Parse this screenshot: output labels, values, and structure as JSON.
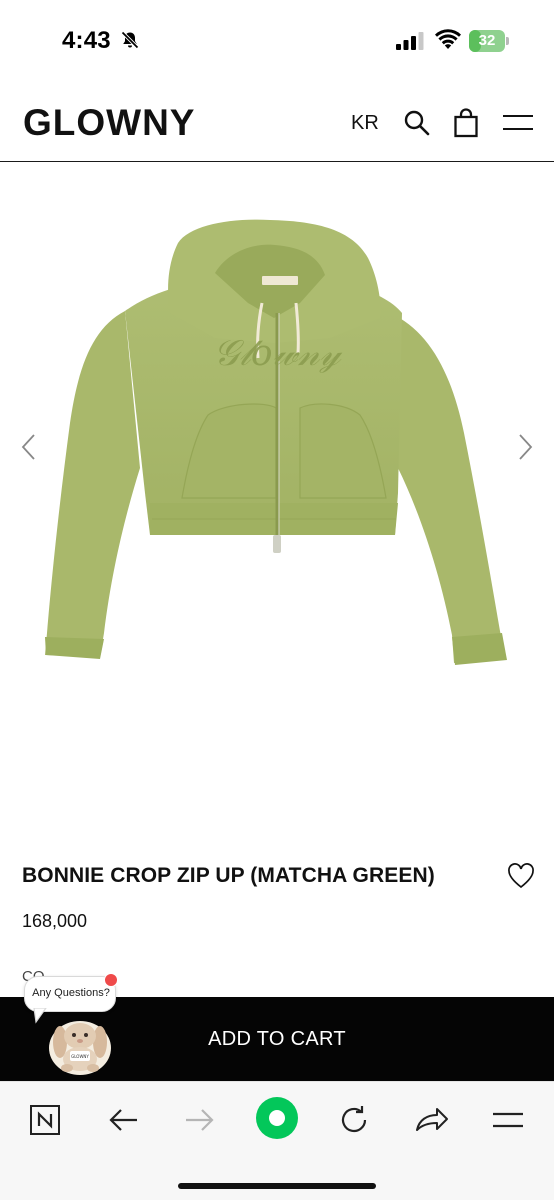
{
  "status_bar": {
    "time": "4:43",
    "battery_level": "32",
    "battery_fraction": 0.32,
    "icons": [
      "bell-slash-icon",
      "signal-icon",
      "wifi-icon",
      "battery-icon"
    ]
  },
  "header": {
    "brand": "GLOWNY",
    "language": "KR",
    "icons": [
      "search-icon",
      "shopping-bag-icon",
      "hamburger-menu-icon"
    ]
  },
  "gallery": {
    "product_color": "#a8b86c",
    "icons": [
      "chevron-left-icon",
      "chevron-right-icon"
    ]
  },
  "product": {
    "title": "BONNIE CROP ZIP UP (MATCHA GREEN)",
    "price": "168,000",
    "option_label_peek": "CO",
    "wishlist_icon": "heart-outline-icon"
  },
  "cart": {
    "add_to_cart_label": "ADD TO CART"
  },
  "chat_widget": {
    "label": "Any Questions?",
    "bunny_shirt_text": "GLOWNY",
    "notification_color": "#ef4a4a"
  },
  "browser_toolbar": {
    "icons": [
      "naver-n-icon",
      "back-arrow-icon",
      "forward-arrow-icon",
      "green-ai-button-icon",
      "reload-icon",
      "share-icon",
      "menu-icon"
    ],
    "accent": "#03c75a"
  }
}
